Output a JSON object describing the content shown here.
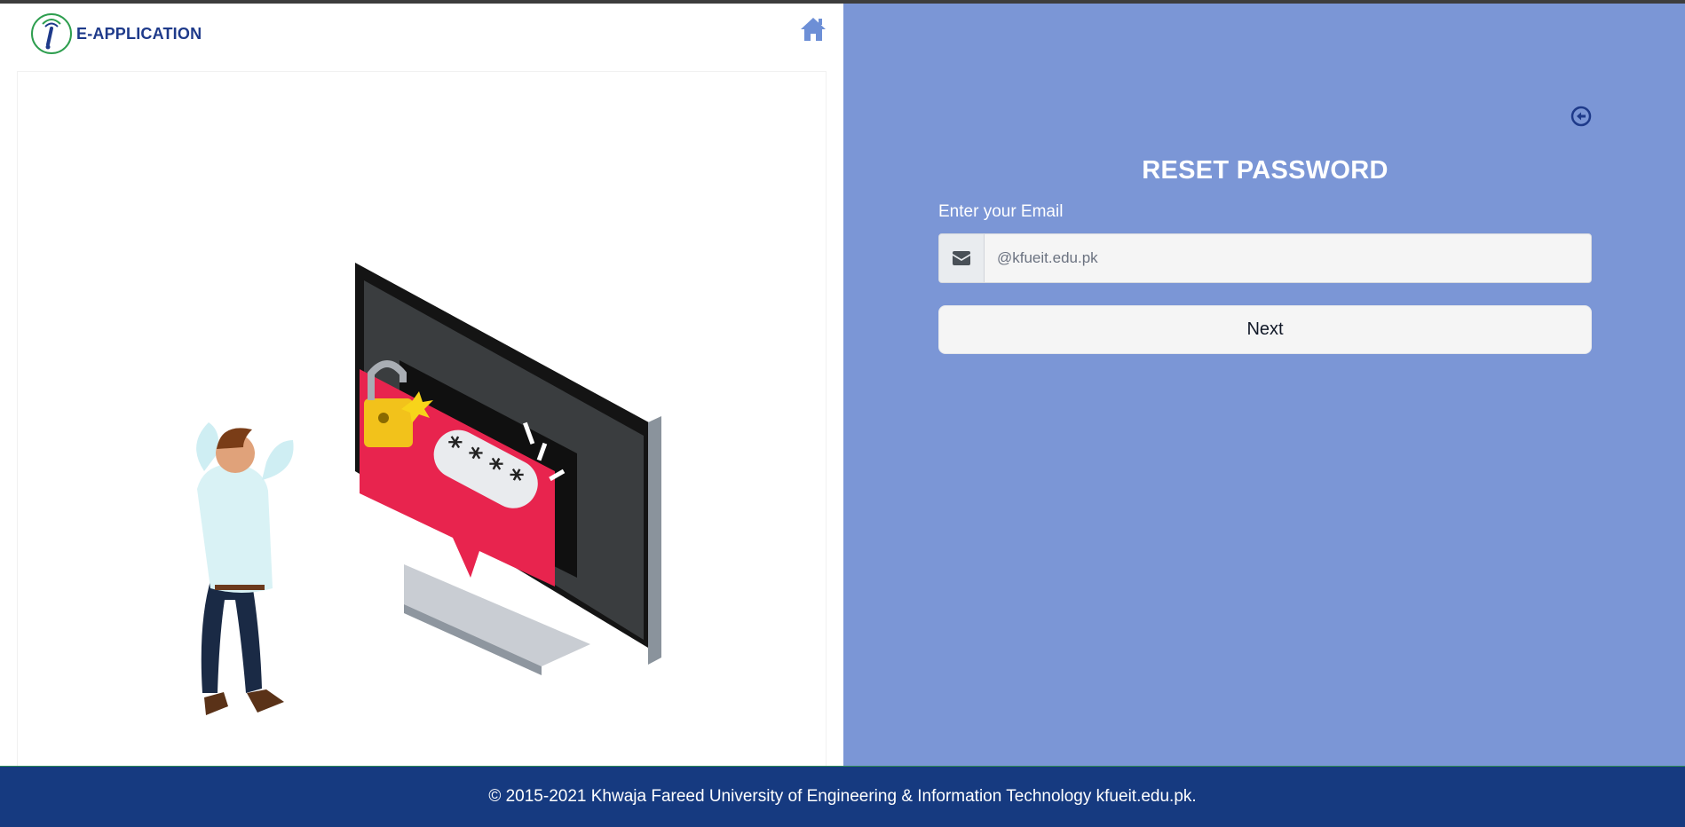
{
  "app": {
    "name": "E-APPLICATION"
  },
  "header": {
    "home_icon": "home-icon",
    "logo_icon": "university-logo-icon"
  },
  "form": {
    "title": "RESET PASSWORD",
    "email_label": "Enter your Email",
    "email_placeholder": "@kfueit.edu.pk",
    "email_value": "",
    "email_icon": "envelope-icon",
    "next_label": "Next",
    "back_icon": "arrow-circle-left-icon"
  },
  "footer": {
    "text": "© 2015-2021 Khwaja Fareed University of Engineering & Information Technology kfueit.edu.pk."
  },
  "colors": {
    "panel_bg": "#7b96d6",
    "footer_bg": "#163a80",
    "brand_text": "#1e3a8a",
    "home_icon": "#6d8fd6"
  }
}
